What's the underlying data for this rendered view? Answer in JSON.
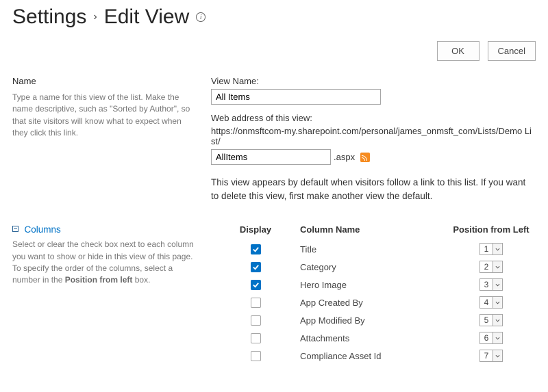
{
  "breadcrumb": {
    "root": "Settings",
    "sep": "›",
    "current": "Edit View"
  },
  "buttons": {
    "ok": "OK",
    "cancel": "Cancel"
  },
  "name_section": {
    "heading": "Name",
    "help": "Type a name for this view of the list. Make the name descriptive, such as \"Sorted by Author\", so that site visitors will know what to expect when they click this link.",
    "view_name_label": "View Name:",
    "view_name_value": "All Items",
    "web_address_label": "Web address of this view:",
    "url_base": "https://onmsftcom-my.sharepoint.com/personal/james_onmsft_com/Lists/Demo List/",
    "url_slug_value": "AllItems",
    "url_suffix": ".aspx",
    "default_note": "This view appears by default when visitors follow a link to this list. If you want to delete this view, first make another view the default."
  },
  "columns_section": {
    "heading": "Columns",
    "help_pre": "Select or clear the check box next to each column you want to show or hide in this view of this page. To specify the order of the columns, select a number in the ",
    "help_bold": "Position from left",
    "help_post": " box.",
    "headers": {
      "display": "Display",
      "name": "Column Name",
      "position": "Position from Left"
    },
    "rows": [
      {
        "checked": true,
        "name": "Title",
        "position": "1"
      },
      {
        "checked": true,
        "name": "Category",
        "position": "2"
      },
      {
        "checked": true,
        "name": "Hero Image",
        "position": "3"
      },
      {
        "checked": false,
        "name": "App Created By",
        "position": "4"
      },
      {
        "checked": false,
        "name": "App Modified By",
        "position": "5"
      },
      {
        "checked": false,
        "name": "Attachments",
        "position": "6"
      },
      {
        "checked": false,
        "name": "Compliance Asset Id",
        "position": "7"
      }
    ]
  }
}
